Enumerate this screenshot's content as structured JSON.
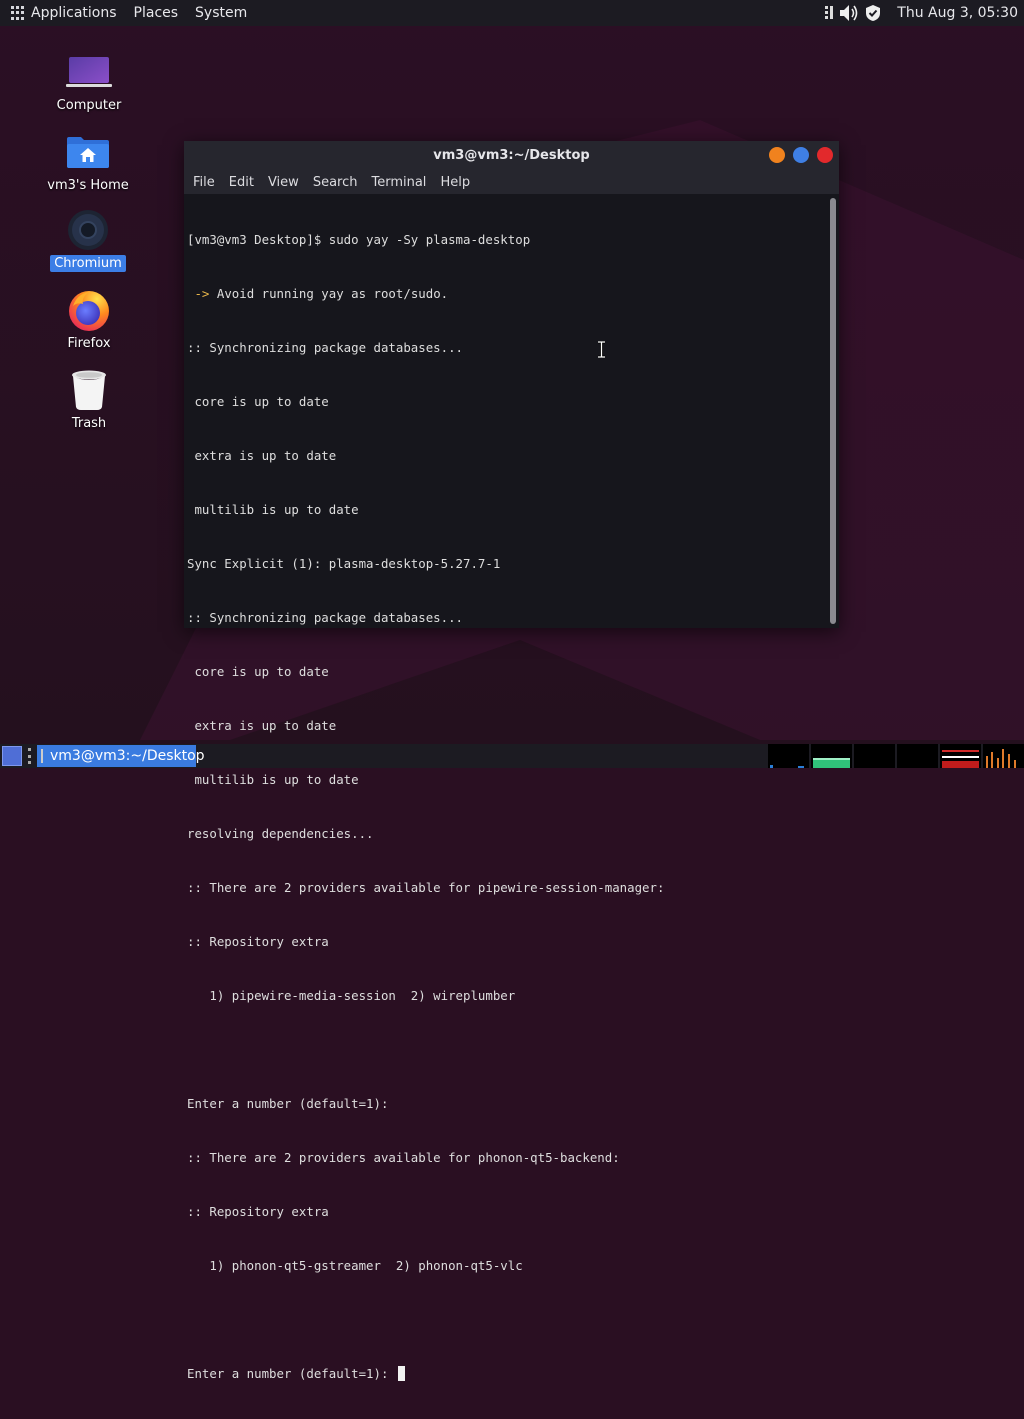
{
  "top_panel": {
    "menus": [
      "Applications",
      "Places",
      "System"
    ],
    "clock": "Thu Aug  3, 05:30",
    "tray_icons": [
      "network-icon",
      "volume-icon",
      "shield-icon"
    ]
  },
  "desktop_icons": [
    {
      "label": "Computer",
      "icon": "computer-icon"
    },
    {
      "label": "vm3's Home",
      "icon": "home-folder-icon"
    },
    {
      "label": "Chromium",
      "icon": "chromium-icon",
      "selected": true
    },
    {
      "label": "Firefox",
      "icon": "firefox-icon"
    },
    {
      "label": "Trash",
      "icon": "trash-icon"
    }
  ],
  "terminal": {
    "title": "vm3@vm3:~/Desktop",
    "menus": [
      "File",
      "Edit",
      "View",
      "Search",
      "Terminal",
      "Help"
    ],
    "lines": [
      "[vm3@vm3 Desktop]$ sudo yay -Sy plasma-desktop",
      "Avoid running yay as root/sudo.",
      ":: Synchronizing package databases...",
      " core is up to date",
      " extra is up to date",
      " multilib is up to date",
      "Sync Explicit (1): plasma-desktop-5.27.7-1",
      ":: Synchronizing package databases...",
      " core is up to date",
      " extra is up to date",
      " multilib is up to date",
      "resolving dependencies...",
      ":: There are 2 providers available for pipewire-session-manager:",
      ":: Repository extra",
      "   1) pipewire-media-session  2) wireplumber",
      "",
      "Enter a number (default=1):",
      ":: There are 2 providers available for phonon-qt5-backend:",
      ":: Repository extra",
      "   1) phonon-qt5-gstreamer  2) phonon-qt5-vlc",
      "",
      "Enter a number (default=1): "
    ],
    "arrow_glyph": " ->"
  },
  "taskbar": {
    "task_label": "vm3@vm3:~/Desktop"
  },
  "colors": {
    "accent": "#3c7ee6",
    "stripe": "#ff1f6e",
    "stripe_warm": "#ff7a2a"
  }
}
